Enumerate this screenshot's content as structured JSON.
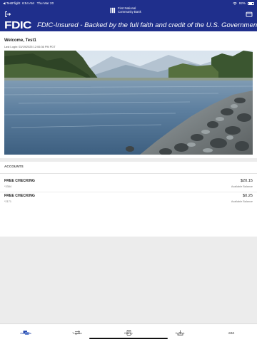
{
  "status_bar": {
    "carrier": "◀ TestFlight",
    "time": "6:54 AM",
    "date": "Thu Mar 20",
    "battery": "92%"
  },
  "header": {
    "bank_name_line1": "First National",
    "bank_name_line2": "Community Bank",
    "fdic_logo": "FDIC",
    "fdic_text": "FDIC-Insured - Backed by the full faith and credit of the U.S. Government",
    "brand_color": "#1f2f8c"
  },
  "welcome": {
    "title": "Welcome, Test1",
    "last_login": "Last Login: 03/19/2025 12:06:36 PM PDT"
  },
  "accounts": {
    "header": "ACCOUNTS",
    "items": [
      {
        "name": "FREE CHECKING",
        "number": "*3384",
        "balance": "$20.15",
        "balance_label": "Available Balance"
      },
      {
        "name": "FREE CHECKING",
        "number": "*2171",
        "balance": "$0.25",
        "balance_label": "Available Balance"
      }
    ]
  },
  "tabbar": {
    "items": [
      {
        "label": "Accounts",
        "icon": "accounts-icon",
        "active": true
      },
      {
        "label": "Transfer",
        "icon": "transfer-icon",
        "active": false
      },
      {
        "label": "BillPay",
        "icon": "billpay-icon",
        "active": false
      },
      {
        "label": "Deposit",
        "icon": "deposit-icon",
        "active": false
      },
      {
        "label": "More",
        "icon": "more-icon",
        "active": false
      }
    ]
  }
}
